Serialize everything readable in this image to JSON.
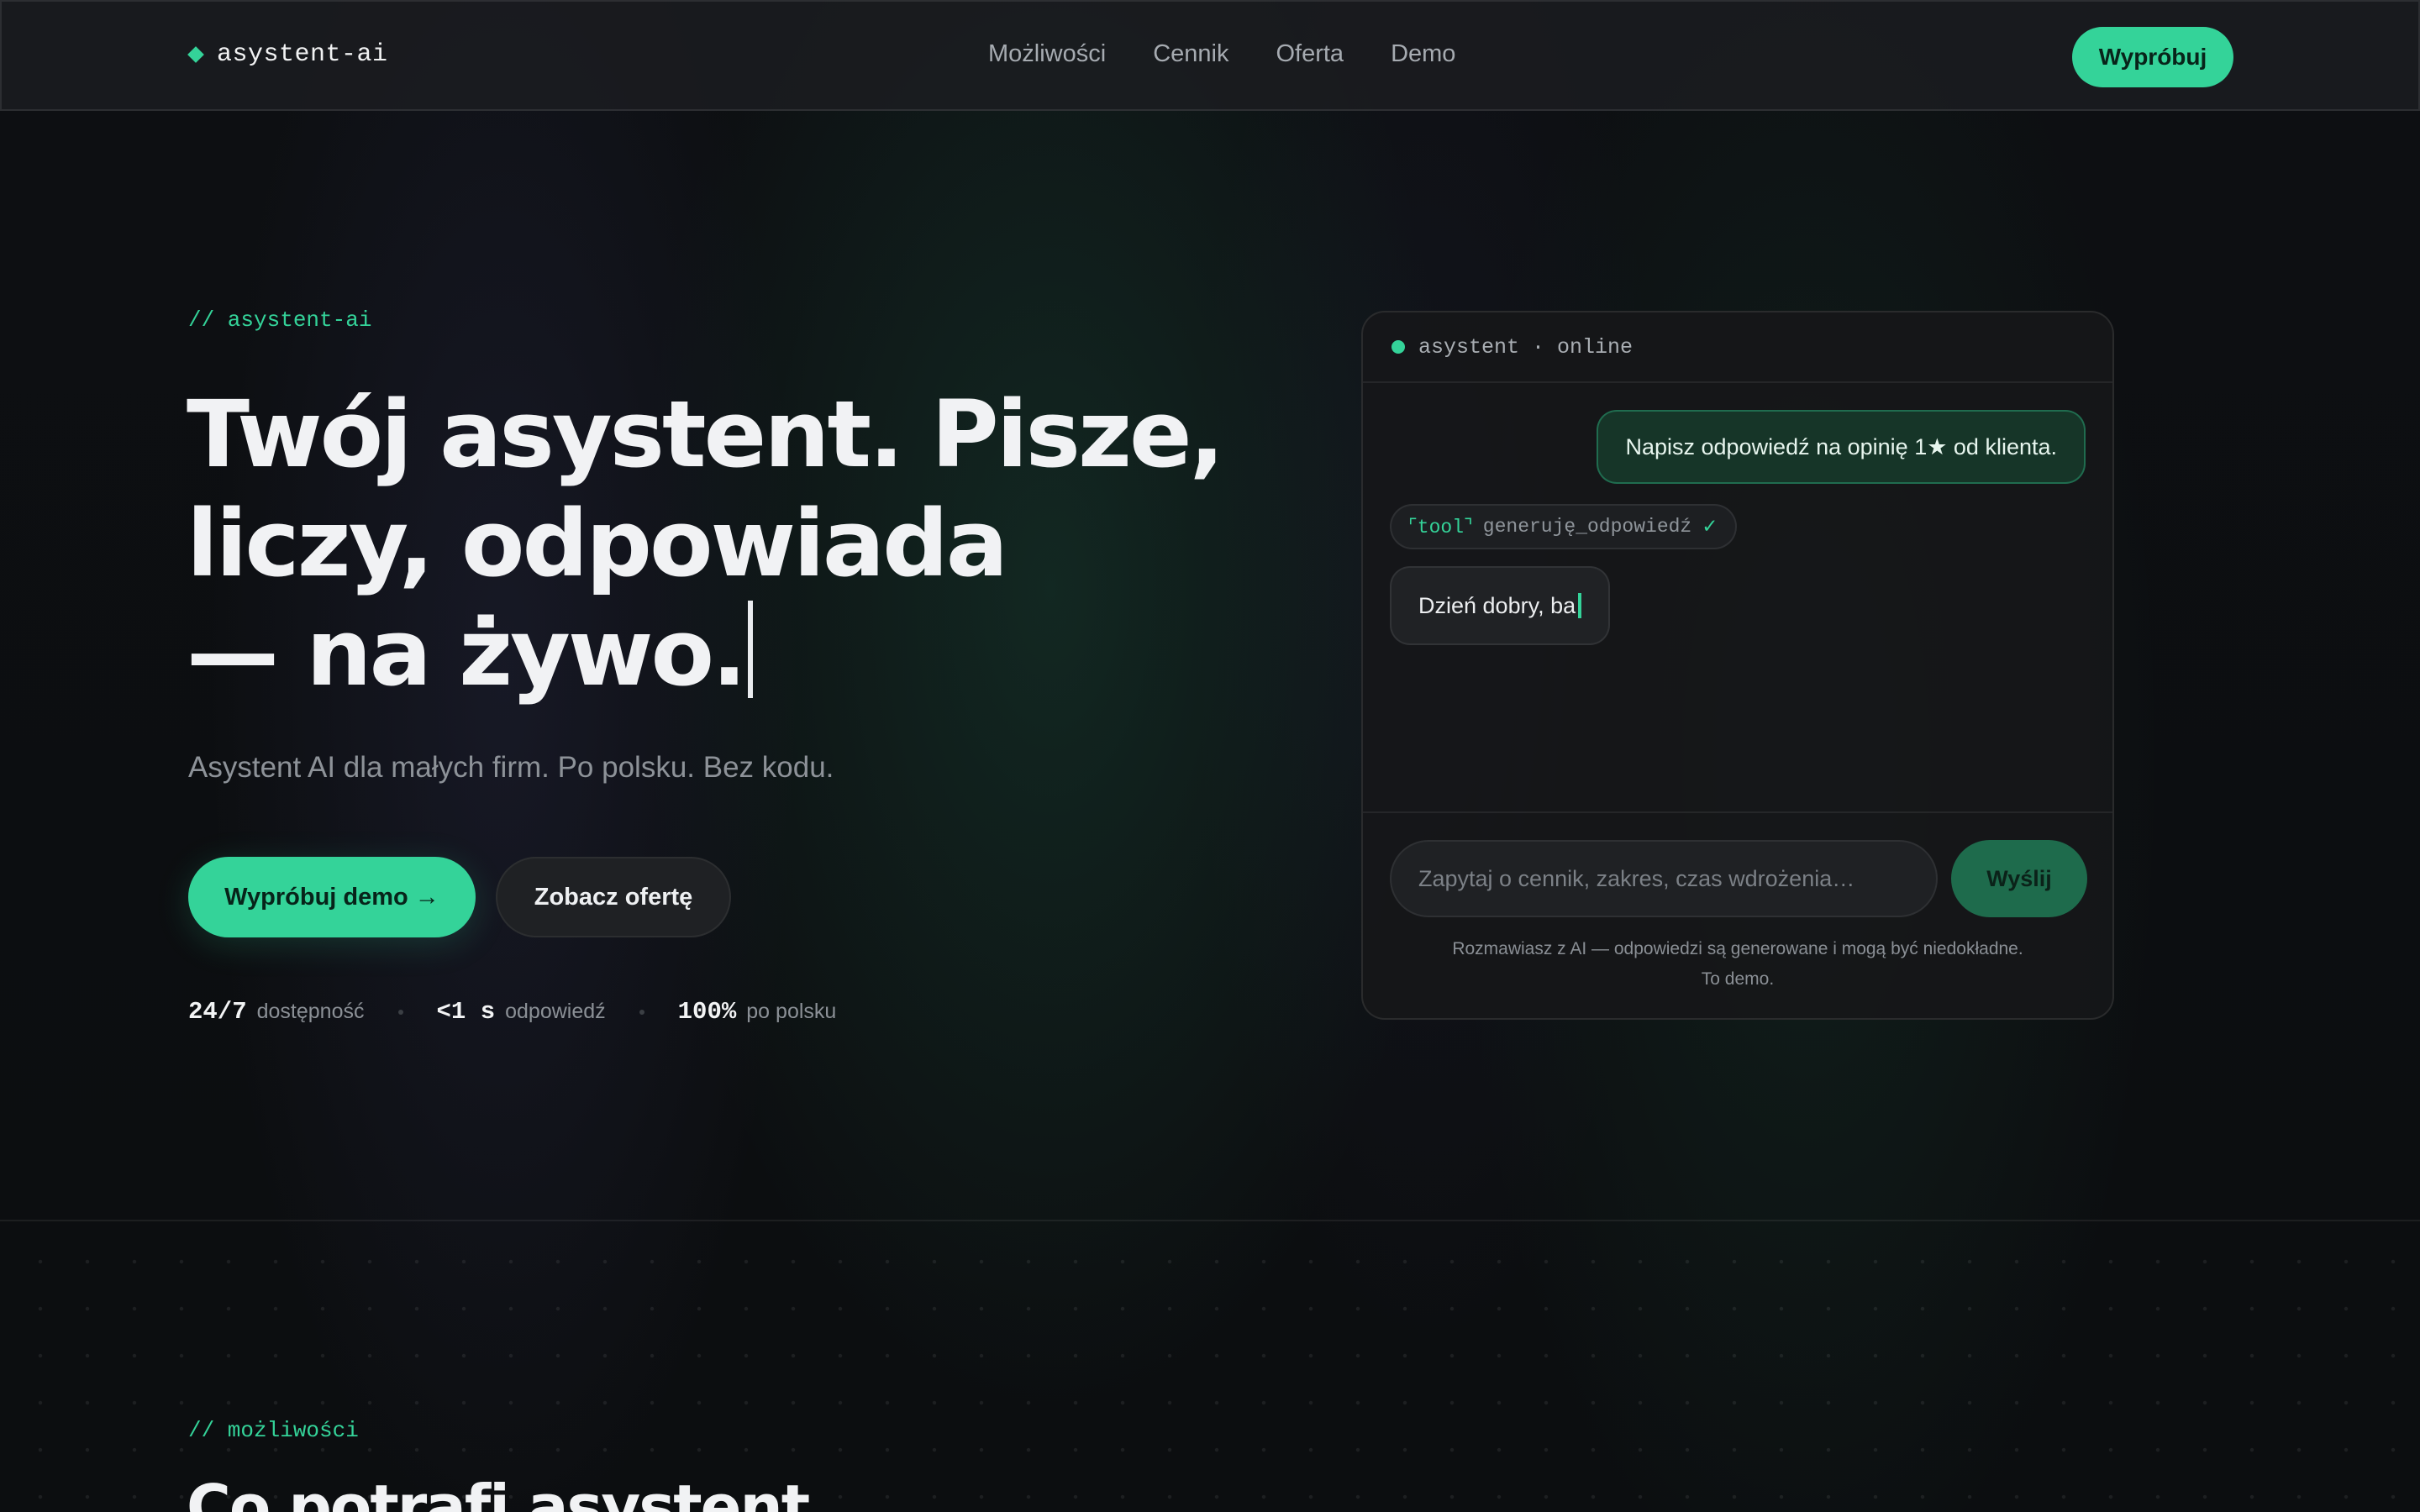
{
  "nav": {
    "brand": "asystent-ai",
    "links": [
      "Możliwości",
      "Cennik",
      "Oferta",
      "Demo"
    ],
    "cta": "Wypróbuj"
  },
  "hero": {
    "kicker": "// asystent-ai",
    "headline": [
      "Twój asystent. Pisze,",
      "liczy, odpowiada",
      "— na żywo."
    ],
    "subtitle": "Asystent AI dla małych firm. Po polsku. Bez kodu.",
    "primary_cta": "Wypróbuj demo →",
    "secondary_cta": "Zobacz ofertę",
    "stats": [
      {
        "value": "24/7",
        "label": "dostępność"
      },
      {
        "value": "<1 s",
        "label": "odpowiedź"
      },
      {
        "value": "100%",
        "label": "po polsku"
      }
    ]
  },
  "chat": {
    "header": "asystent · online",
    "user_message": "Napisz odpowiedź na opinię 1★ od klienta.",
    "tool": {
      "tag": "⌜tool⌝",
      "text": "generuję_odpowiedź",
      "check": "✓"
    },
    "bot_message": "Dzień dobry, ba",
    "input_placeholder": "Zapytaj o cennik, zakres, czas wdrożenia…",
    "send": "Wyślij",
    "disclaimer_line1": "Rozmawiasz z AI — odpowiedzi są generowane i mogą być niedokładne.",
    "disclaimer_line2": "To demo."
  },
  "section": {
    "kicker": "// możliwości",
    "title": "Co potrafi asystent"
  },
  "colors": {
    "accent": "#34d399",
    "background": "#0c0d10",
    "user_bubble": "#163528"
  }
}
